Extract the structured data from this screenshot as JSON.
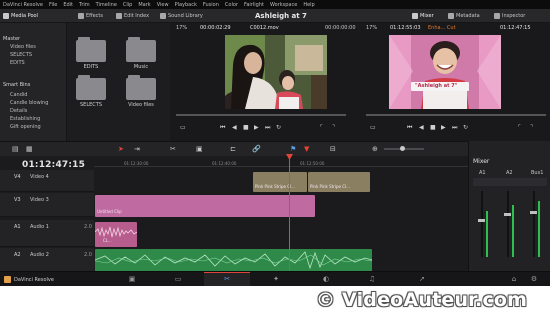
{
  "menu": [
    "DaVinci Resolve",
    "File",
    "Edit",
    "Trim",
    "Timeline",
    "Clip",
    "Mark",
    "View",
    "Playback",
    "Fusion",
    "Color",
    "Fairlight",
    "Workspace",
    "Help"
  ],
  "toolbar": {
    "media_pool": "Media Pool",
    "effects": "Effects",
    "edit_index": "Edit Index",
    "sound_library": "Sound Library",
    "project_title": "Ashleigh at 7",
    "mixer": "Mixer",
    "metadata": "Metadata",
    "inspector": "Inspector"
  },
  "bins": {
    "master": "Master",
    "items": [
      "Video files",
      "SELECTS",
      "EDITS"
    ],
    "smart_bins": "Smart Bins",
    "smart_items": [
      "Candid",
      "Candle blowing",
      "Details",
      "Establishing",
      "Gift opening"
    ]
  },
  "media_pool": {
    "folders": [
      "EDITS",
      "Music",
      "SELECTS",
      "Video files"
    ]
  },
  "source_viewer": {
    "zoom": "17%",
    "timecode": "00:00:02:29",
    "clip_name": "C0012.mov",
    "in_timecode": "00:00:00:00"
  },
  "timeline_viewer": {
    "zoom": "17%",
    "timecode": "01:12:55:03",
    "clip_name": "Enha... Cut",
    "in_timecode": "01:12:47:15",
    "title_overlay": "\"Ashleigh at 7\""
  },
  "timeline": {
    "timecode": "01:12:47:15",
    "ruler": [
      "01:12:30:00",
      "01:12:40:00",
      "01:12:50:00"
    ],
    "tracks": [
      {
        "id": "V4",
        "name": "Video 4"
      },
      {
        "id": "V3",
        "name": "Video 3"
      },
      {
        "id": "A1",
        "name": "Audio 1",
        "level": "2.0"
      },
      {
        "id": "A2",
        "name": "Audio 2",
        "level": "2.0"
      }
    ],
    "clips": {
      "v4_a": "Pink Pink Stripe Cl...",
      "v4_b": "Pink Pink Stripe Cl...",
      "v3": "Untitled Clip",
      "a1": "CL..."
    }
  },
  "mixer": {
    "title": "Mixer",
    "channels": [
      "A1",
      "A2",
      "Bus1"
    ]
  },
  "pagebar": {
    "app_name": "DaVinci Resolve"
  },
  "watermark": "© VideoAuteur.com",
  "colors": {
    "accent_orange": "#e67a2e",
    "playhead": "#e0443a",
    "pink_clip": "#c06aa2",
    "tan_clip": "#8a7f60",
    "audio_green": "#2f8a4a",
    "audio_pink": "#b65d8d"
  }
}
